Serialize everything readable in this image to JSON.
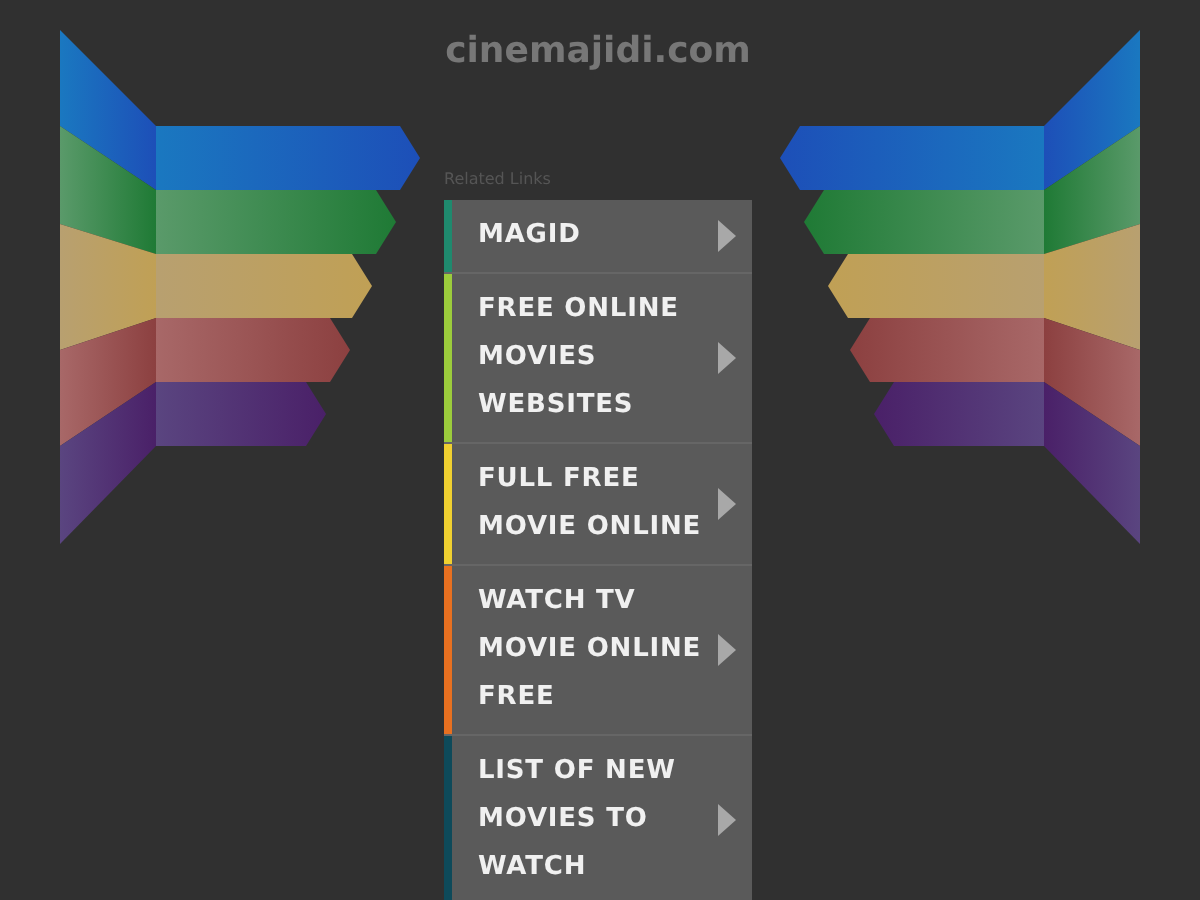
{
  "site_title": "cinemajidi.com",
  "related_links_label": "Related Links",
  "links": [
    {
      "label": "MAGID",
      "color": "#1f8a6e"
    },
    {
      "label": "FREE ONLINE MOVIES WEBSITES",
      "color": "#9ccc3c"
    },
    {
      "label": "FULL FREE MOVIE ONLINE",
      "color": "#f0d030"
    },
    {
      "label": "WATCH TV MOVIE ONLINE FREE",
      "color": "#e87020"
    },
    {
      "label": "LIST OF NEW MOVIES TO WATCH",
      "color": "#0e4a5a"
    }
  ]
}
